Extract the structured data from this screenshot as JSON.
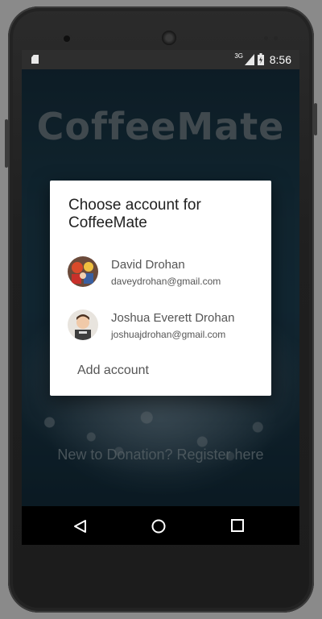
{
  "status_bar": {
    "time": "8:56",
    "network": "3G",
    "icons": [
      "sd-card-icon",
      "signal-icon",
      "battery-icon"
    ]
  },
  "background_app": {
    "title": "CoffeeMate",
    "register_link": "New to Donation? Register here"
  },
  "dialog": {
    "title": "Choose account for CoffeeMate",
    "accounts": [
      {
        "name": "David Drohan",
        "email": "daveydrohan@gmail.com"
      },
      {
        "name": "Joshua Everett Drohan",
        "email": "joshuajdrohan@gmail.com"
      }
    ],
    "add_account_label": "Add account"
  },
  "nav_bar": {
    "icons": [
      "back-icon",
      "home-icon",
      "recents-icon"
    ]
  }
}
